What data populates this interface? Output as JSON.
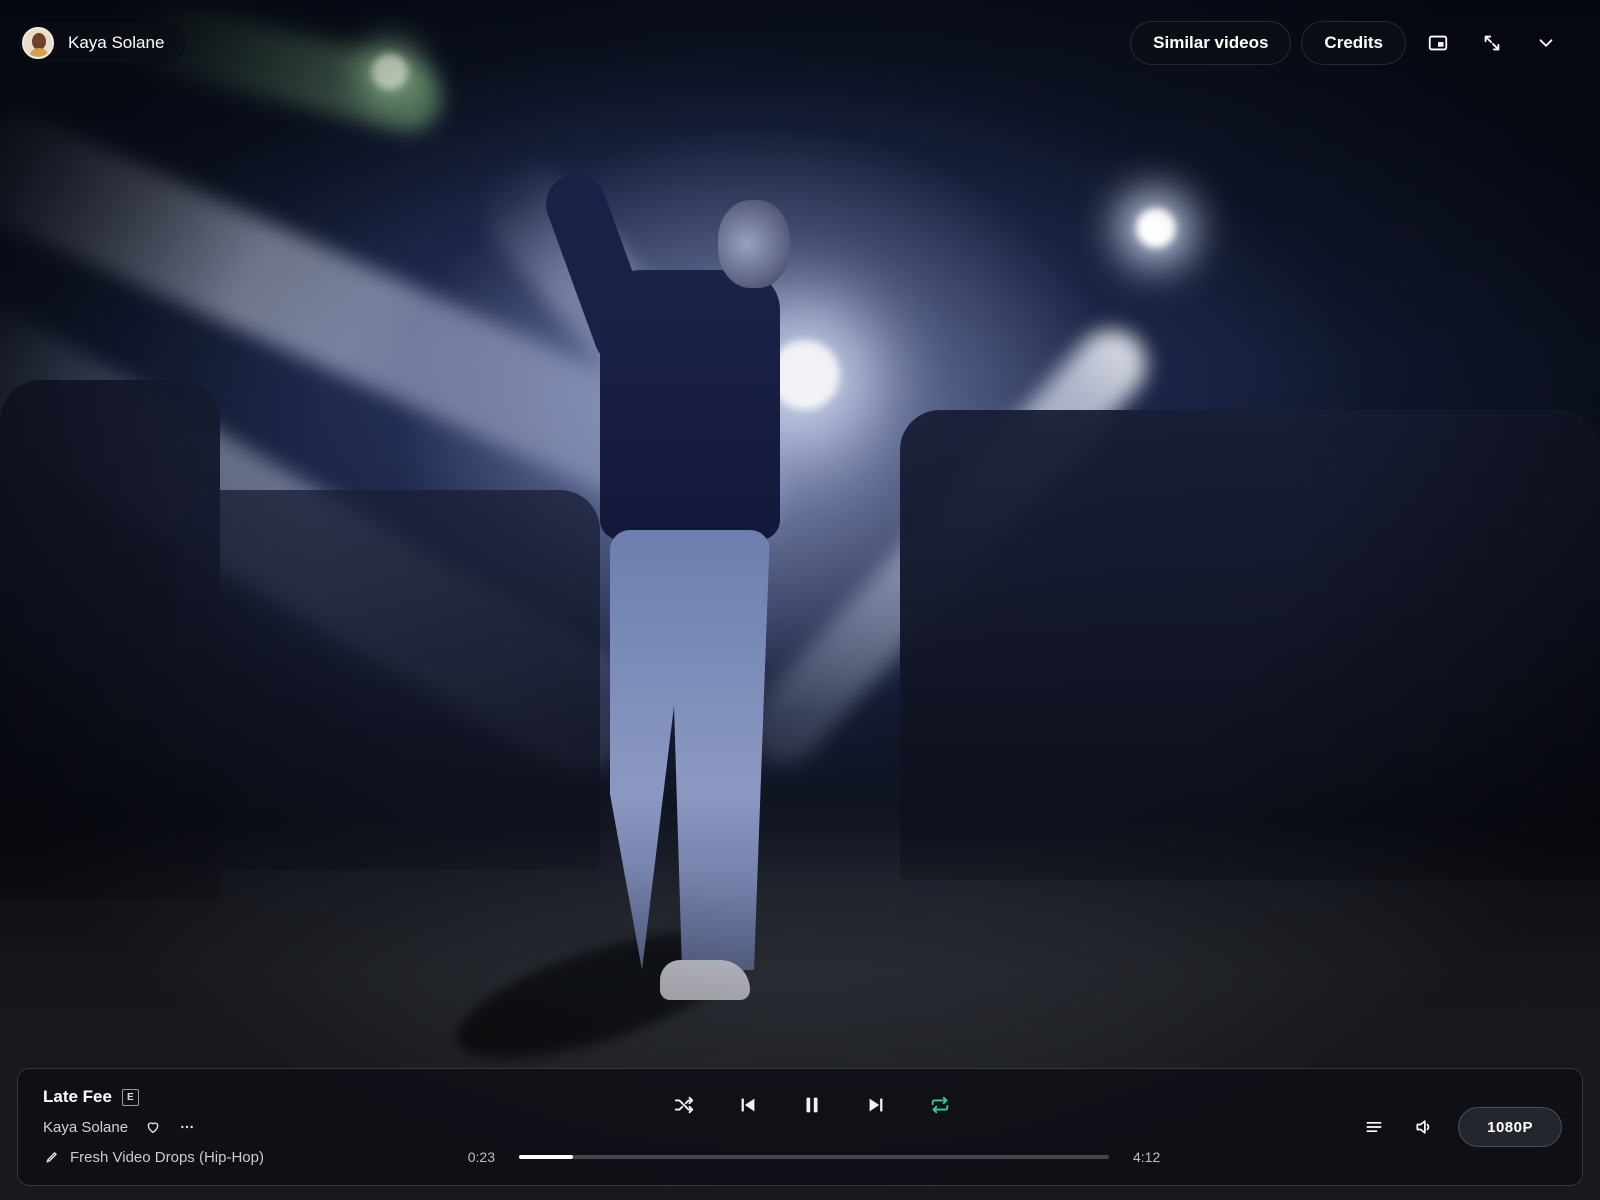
{
  "video": {
    "description_icon": "video-frame"
  },
  "top_bar": {
    "artist_name": "Kaya Solane",
    "similar_label": "Similar videos",
    "credits_label": "Credits",
    "icons": [
      "pip-icon",
      "fullscreen-icon",
      "chevron-down-icon"
    ]
  },
  "player": {
    "title": "Late Fee",
    "explicit_badge": "E",
    "artist": "Kaya Solane",
    "playlist": "Fresh Video Drops (Hip-Hop)",
    "elapsed": "0:23",
    "total": "4:12",
    "progress_fraction": 0.091,
    "quality": "1080P",
    "shuffle_on": false,
    "repeat_on": true,
    "accent_color": "#2bd0a2"
  }
}
